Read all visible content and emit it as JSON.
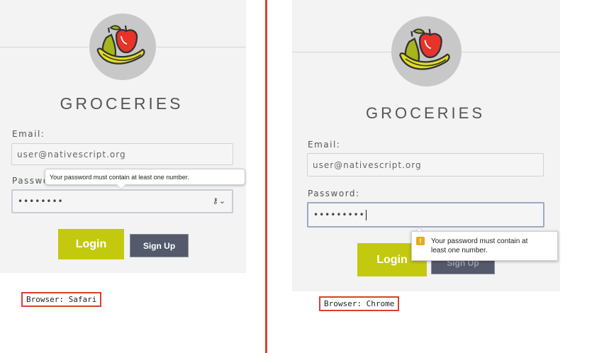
{
  "safari": {
    "brand": "GROCERIES",
    "email_label": "Email:",
    "email_value": "user@nativescript.org",
    "password_label": "Password:",
    "password_value": "••••••••",
    "keychain_icon": "key-icon",
    "tooltip": "Your password must contain at least one number.",
    "login_label": "Login",
    "signup_label": "Sign Up",
    "caption": "Browser: Safari"
  },
  "chrome": {
    "brand": "GROCERIES",
    "email_label": "Email:",
    "email_value": "user@nativescript.org",
    "password_label": "Password:",
    "password_value": "•••••••••",
    "tooltip_line1": "Your password must contain at",
    "tooltip_line2": "least one number.",
    "warning_icon": "!",
    "login_label": "Login",
    "signup_label": "Sign Up",
    "caption": "Browser: Chrome"
  },
  "colors": {
    "login_button": "#c3c90e",
    "signup_button": "#54596b",
    "divider": "#d9402b",
    "logo_circle": "#c8c8c8",
    "warning": "#e8a920"
  }
}
